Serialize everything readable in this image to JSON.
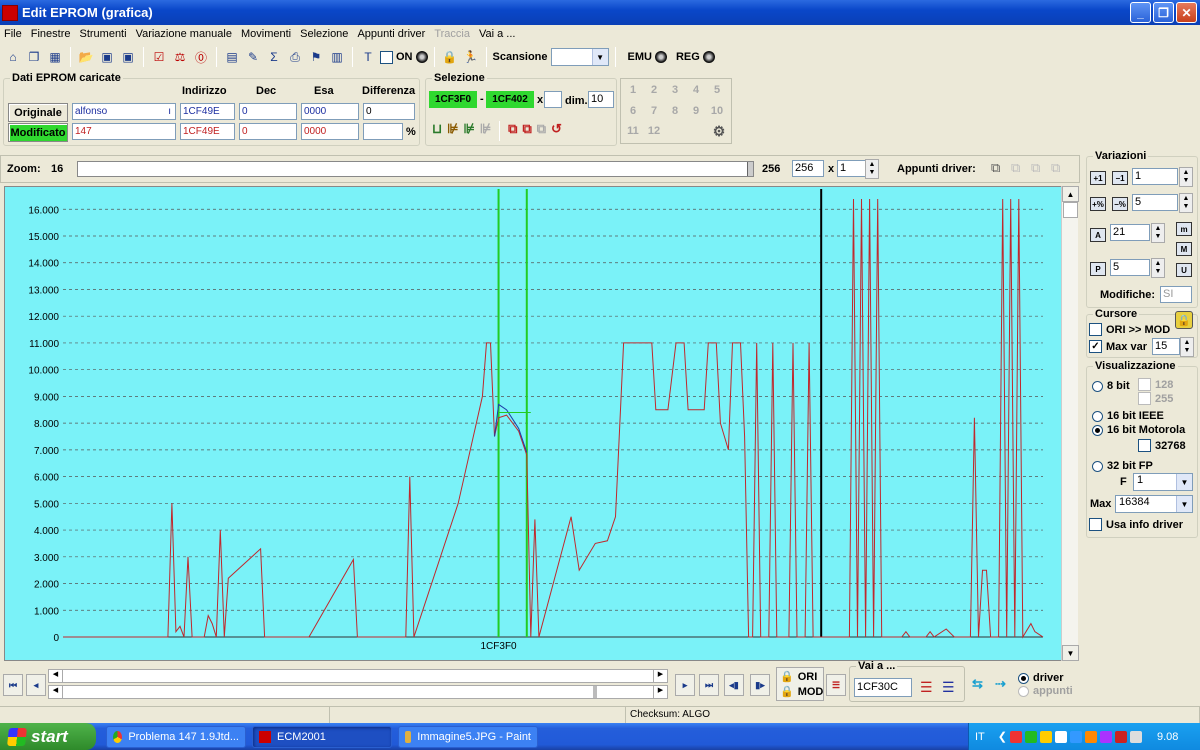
{
  "window": {
    "title": "Edit EPROM (grafica)",
    "buttons": [
      "_",
      "❐",
      "✕"
    ]
  },
  "menu": [
    "File",
    "Finestre",
    "Strumenti",
    "Variazione manuale",
    "Movimenti",
    "Selezione",
    "Appunti driver",
    "Traccia",
    "Vai a ..."
  ],
  "menu_disabled": "Traccia",
  "toolbar": {
    "on_label": "ON",
    "scansione_label": "Scansione",
    "scansione_value": "",
    "emu_label": "EMU",
    "reg_label": "REG"
  },
  "dati": {
    "legend": "Dati EPROM caricate",
    "headers": {
      "indirizzo": "Indirizzo",
      "dec": "Dec",
      "esa": "Esa",
      "differenza": "Differenza"
    },
    "originale": {
      "label": "Originale",
      "name": "alfonso",
      "address": "1CF49E",
      "dec": "0",
      "esa": "0000",
      "diff": "0"
    },
    "modificato": {
      "label": "Modificato",
      "name": "147",
      "address": "1CF49E",
      "dec": "0",
      "esa": "0000",
      "diff": "",
      "percent": "%"
    },
    "name_suffix": "ı"
  },
  "selezione": {
    "legend": "Selezione",
    "start": "1CF3F0",
    "dash": "-",
    "end": "1CF402",
    "x_label": "x",
    "x_value": "",
    "dim_label": "dim.",
    "dim_value": "10"
  },
  "numgrid": [
    "1",
    "2",
    "3",
    "4",
    "5",
    "6",
    "7",
    "8",
    "9",
    "10",
    "11",
    "12"
  ],
  "zoom": {
    "label": "Zoom:",
    "value": "16",
    "max_label": "256",
    "max_value": "256",
    "x_label": "x",
    "mult": "1"
  },
  "appunti_label": "Appunti driver:",
  "variazioni": {
    "legend": "Variazioni",
    "v1": "1",
    "v2": "5",
    "v3": "21",
    "v4": "5",
    "modifiche_label": "Modifiche:",
    "modifiche_value": "SI"
  },
  "cursore": {
    "legend": "Cursore",
    "ori_mod": "ORI >> MOD",
    "max_var_label": "Max var",
    "max_var_value": "15",
    "ori_checked": false,
    "maxvar_checked": true
  },
  "visualizzazione": {
    "legend": "Visualizzazione",
    "r8": "8 bit",
    "c128": "128",
    "c255": "255",
    "r16ieee": "16 bit IEEE",
    "r16mot": "16 bit Motorola",
    "c32768": "32768",
    "r32fp": "32 bit FP",
    "f_label": "F",
    "f_value": "1",
    "max_label": "Max",
    "max_value": "16384",
    "usa_info": "Usa info driver",
    "selected": "16 bit Motorola"
  },
  "bottom": {
    "ori": "ORI",
    "mod": "MOD",
    "vai_a": "Vai a ...",
    "vai_value": "1CF30C",
    "driver": "driver",
    "appunti": "appunti"
  },
  "status": {
    "checksum": "Checksum: ALGO"
  },
  "taskbar": {
    "start": "start",
    "tasks": [
      "Problema 147 1.9Jtd...",
      "ECM2001",
      "Immagine5.JPG - Paint"
    ],
    "lang": "IT",
    "time": "9.08"
  },
  "colors": {
    "plot_bg": "#7af2f8",
    "series_mod": "#c0282c",
    "series_ori": "#1e3ca8",
    "selection": "#22cc22",
    "cursor": "#000000"
  },
  "chart_data": {
    "type": "line",
    "x_tick_label": "1CF3F0",
    "ylim": [
      0,
      16384
    ],
    "yticks": [
      0,
      1000,
      2000,
      3000,
      4000,
      5000,
      6000,
      7000,
      8000,
      9000,
      10000,
      11000,
      12000,
      13000,
      14000,
      15000,
      16000
    ],
    "ytick_labels": [
      "0",
      "1.000",
      "2.000",
      "3.000",
      "4.000",
      "5.000",
      "6.000",
      "7.000",
      "8.000",
      "9.000",
      "10.000",
      "11.000",
      "12.000",
      "13.000",
      "14.000",
      "15.000",
      "16.000"
    ],
    "grid": true,
    "n_points": 244,
    "selection_range": [
      108,
      115
    ],
    "cursor_index": 188,
    "series": [
      {
        "points": [
          [
            0,
            0
          ],
          [
            26,
            0
          ],
          [
            27,
            5000
          ],
          [
            28,
            200
          ],
          [
            29,
            400
          ],
          [
            30,
            0
          ],
          [
            31,
            3000
          ],
          [
            32,
            0
          ],
          [
            35,
            0
          ],
          [
            36,
            800
          ],
          [
            37,
            500
          ],
          [
            38,
            0
          ],
          [
            39,
            4000
          ],
          [
            40,
            0
          ],
          [
            41,
            2200
          ],
          [
            49,
            3300
          ],
          [
            50,
            0
          ],
          [
            61,
            0
          ],
          [
            72,
            2900
          ],
          [
            73,
            0
          ],
          [
            85,
            0
          ],
          [
            86,
            6000
          ],
          [
            87,
            0
          ],
          [
            98,
            5000
          ],
          [
            104,
            9000
          ],
          [
            105,
            11000
          ],
          [
            106,
            11000
          ],
          [
            107,
            7500
          ],
          [
            108,
            8200
          ],
          [
            110,
            8300
          ],
          [
            113,
            7700
          ],
          [
            115,
            6800
          ],
          [
            116,
            0
          ],
          [
            117,
            4400
          ],
          [
            118,
            0
          ],
          [
            126,
            4500
          ],
          [
            128,
            2500
          ],
          [
            132,
            3500
          ],
          [
            135,
            3600
          ],
          [
            137,
            4500
          ],
          [
            139,
            11000
          ],
          [
            145,
            11000
          ],
          [
            146,
            11000
          ],
          [
            147,
            8500
          ],
          [
            150,
            8500
          ],
          [
            152,
            11000
          ],
          [
            154,
            11000
          ],
          [
            155,
            8500
          ],
          [
            159,
            8500
          ],
          [
            160,
            11000
          ],
          [
            162,
            11000
          ],
          [
            163,
            8000
          ],
          [
            165,
            7000
          ],
          [
            166,
            11000
          ],
          [
            168,
            11000
          ],
          [
            169,
            7500
          ],
          [
            170,
            0
          ],
          [
            171,
            0
          ],
          [
            172,
            11000
          ],
          [
            173,
            0
          ],
          [
            175,
            0
          ],
          [
            176,
            11000
          ],
          [
            177,
            0
          ],
          [
            180,
            0
          ],
          [
            181,
            11000
          ],
          [
            182,
            0
          ],
          [
            184,
            0
          ],
          [
            185,
            11000
          ],
          [
            186,
            0
          ],
          [
            188,
            0
          ],
          [
            189,
            0
          ],
          [
            195,
            0
          ],
          [
            196,
            16384
          ],
          [
            197,
            0
          ],
          [
            198,
            16384
          ],
          [
            199,
            0
          ],
          [
            200,
            16384
          ],
          [
            201,
            0
          ],
          [
            202,
            16384
          ],
          [
            203,
            0
          ],
          [
            208,
            0
          ],
          [
            209,
            200
          ],
          [
            210,
            0
          ],
          [
            214,
            0
          ],
          [
            215,
            200
          ],
          [
            216,
            0
          ],
          [
            219,
            300
          ],
          [
            221,
            0
          ],
          [
            225,
            0
          ],
          [
            226,
            8200
          ],
          [
            227,
            0
          ],
          [
            228,
            2500
          ],
          [
            229,
            2500
          ],
          [
            230,
            0
          ],
          [
            232,
            0
          ],
          [
            233,
            16384
          ],
          [
            234,
            0
          ],
          [
            235,
            16384
          ],
          [
            236,
            0
          ],
          [
            237,
            16384
          ],
          [
            238,
            0
          ],
          [
            240,
            500
          ],
          [
            241,
            200
          ],
          [
            243,
            0
          ]
        ]
      },
      {
        "points": [
          [
            107,
            7500
          ],
          [
            108,
            8700
          ],
          [
            110,
            8500
          ],
          [
            113,
            7800
          ],
          [
            115,
            6900
          ]
        ]
      }
    ]
  }
}
